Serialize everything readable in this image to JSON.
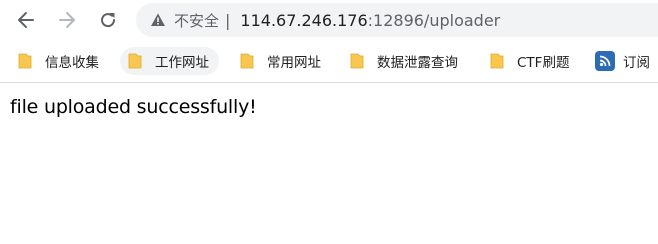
{
  "toolbar": {
    "back_icon": "arrow-left-icon",
    "forward_icon": "arrow-right-icon",
    "reload_icon": "reload-icon"
  },
  "omnibox": {
    "security_icon": "warning-triangle-icon",
    "security_label": "不安全",
    "separator": "|",
    "url_host": "114.67.246.176",
    "url_rest": ":12896/uploader"
  },
  "bookmarks": [
    {
      "label": "信息收集",
      "icon": "folder-icon"
    },
    {
      "label": "工作网址",
      "icon": "folder-icon"
    },
    {
      "label": "常用网址",
      "icon": "folder-icon"
    },
    {
      "label": "数据泄露查询",
      "icon": "folder-icon"
    },
    {
      "label": "CTF刷题",
      "icon": "folder-icon"
    },
    {
      "label": "订阅",
      "icon": "rss-icon"
    }
  ],
  "page": {
    "message": "file uploaded successfully!"
  },
  "colors": {
    "folder": "#f9c74f",
    "rss": "#2d6cb5",
    "omnibox_bg": "#f1f3f4"
  }
}
